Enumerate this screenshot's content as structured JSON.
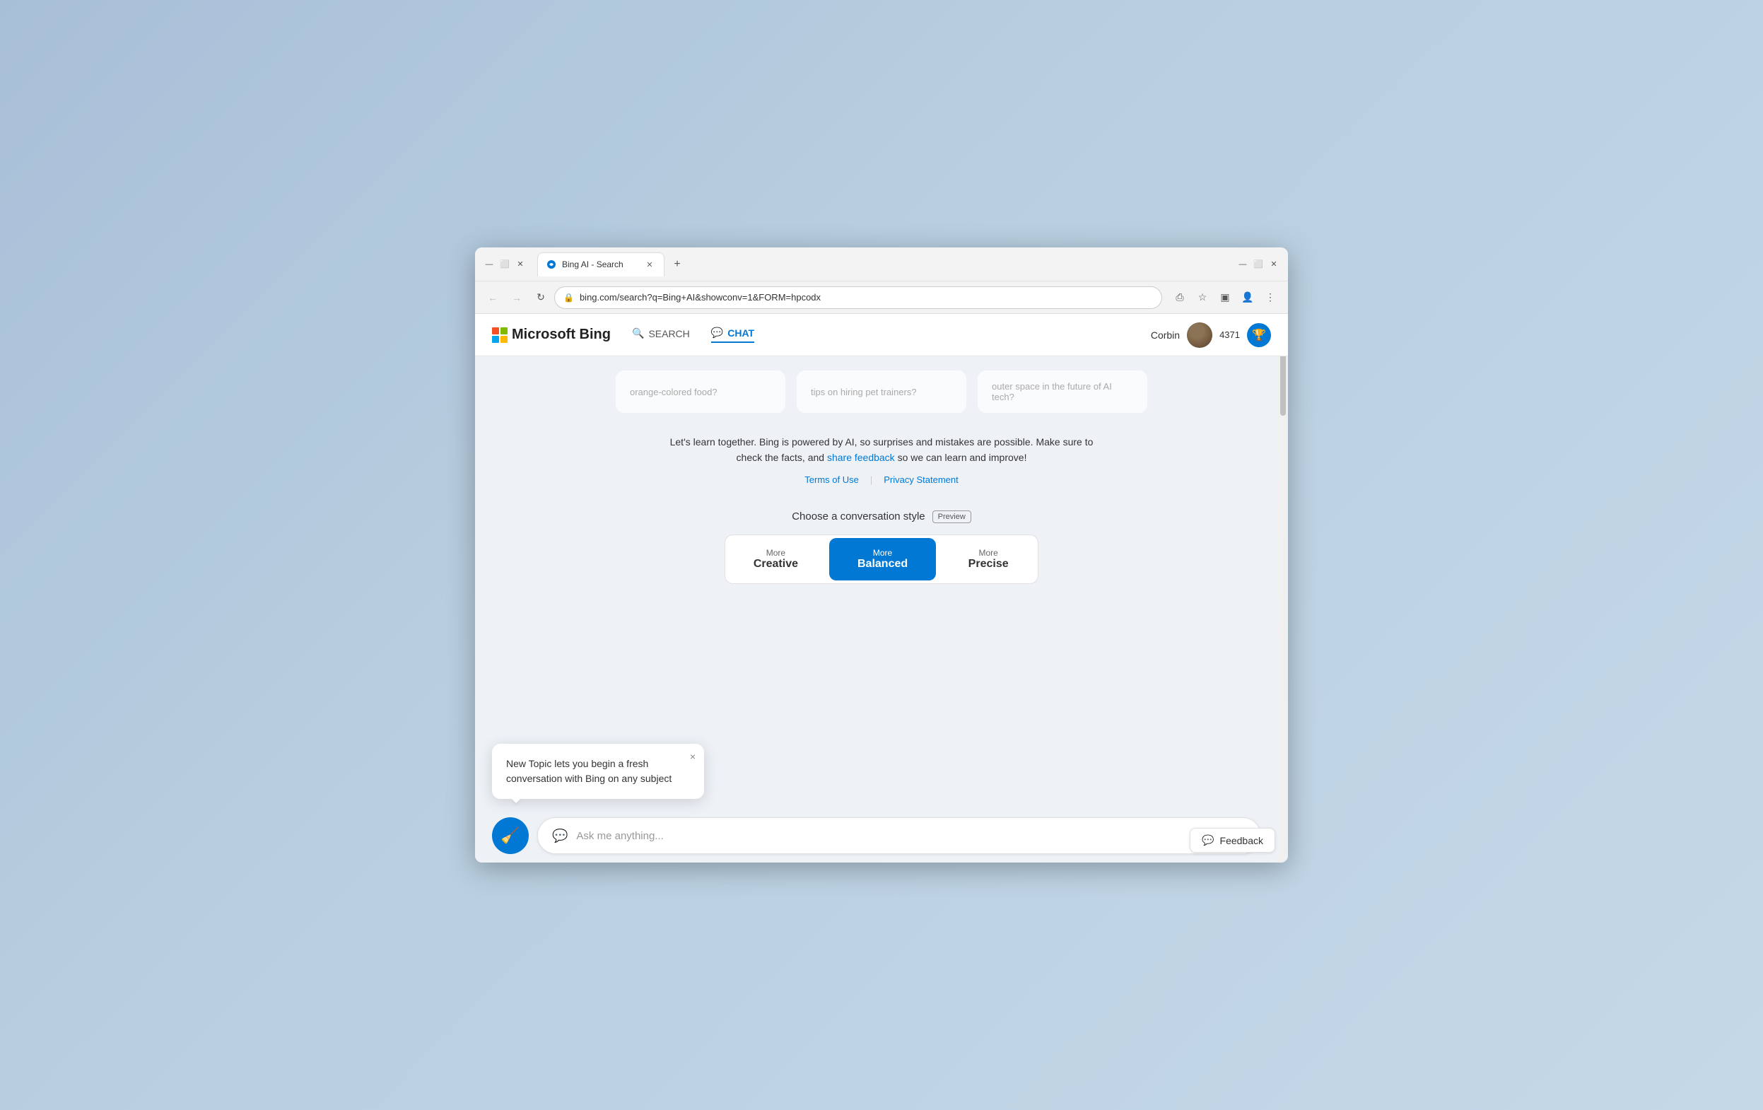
{
  "browser": {
    "tab_title": "Bing AI - Search",
    "url": "bing.com/search?q=Bing+AI&showconv=1&FORM=hpcodx",
    "new_tab_icon": "+",
    "back_disabled": true,
    "forward_disabled": true
  },
  "header": {
    "logo_text": "Bing",
    "nav_items": [
      {
        "id": "search",
        "label": "SEARCH",
        "active": false
      },
      {
        "id": "chat",
        "label": "CHAT",
        "active": true
      }
    ],
    "user_name": "Corbin",
    "points": "4371"
  },
  "suggestions": [
    {
      "text": "orange-colored food?"
    },
    {
      "text": "tips on hiring pet trainers?"
    },
    {
      "text": "outer space in the future of AI tech?"
    }
  ],
  "disclaimer": {
    "text_before": "Let's learn together. Bing is powered by AI, so surprises and mistakes are possible. Make sure to check the facts, and ",
    "link_text": "share feedback",
    "text_after": " so we can learn and improve!"
  },
  "legal": {
    "terms_label": "Terms of Use",
    "privacy_label": "Privacy Statement",
    "separator": "|"
  },
  "style_selector": {
    "label": "Choose a conversation style",
    "preview_badge": "Preview",
    "buttons": [
      {
        "id": "creative",
        "more": "More",
        "name": "Creative",
        "active": false
      },
      {
        "id": "balanced",
        "more": "More",
        "name": "Balanced",
        "active": true
      },
      {
        "id": "precise",
        "more": "More",
        "name": "Precise",
        "active": false
      }
    ]
  },
  "input": {
    "placeholder": "Ask me anything...",
    "new_topic_tooltip": "New Topic"
  },
  "tooltip": {
    "text": "New Topic lets you begin a fresh conversation with Bing on any subject",
    "close_label": "×"
  },
  "feedback": {
    "label": "Feedback",
    "icon": "💬"
  }
}
